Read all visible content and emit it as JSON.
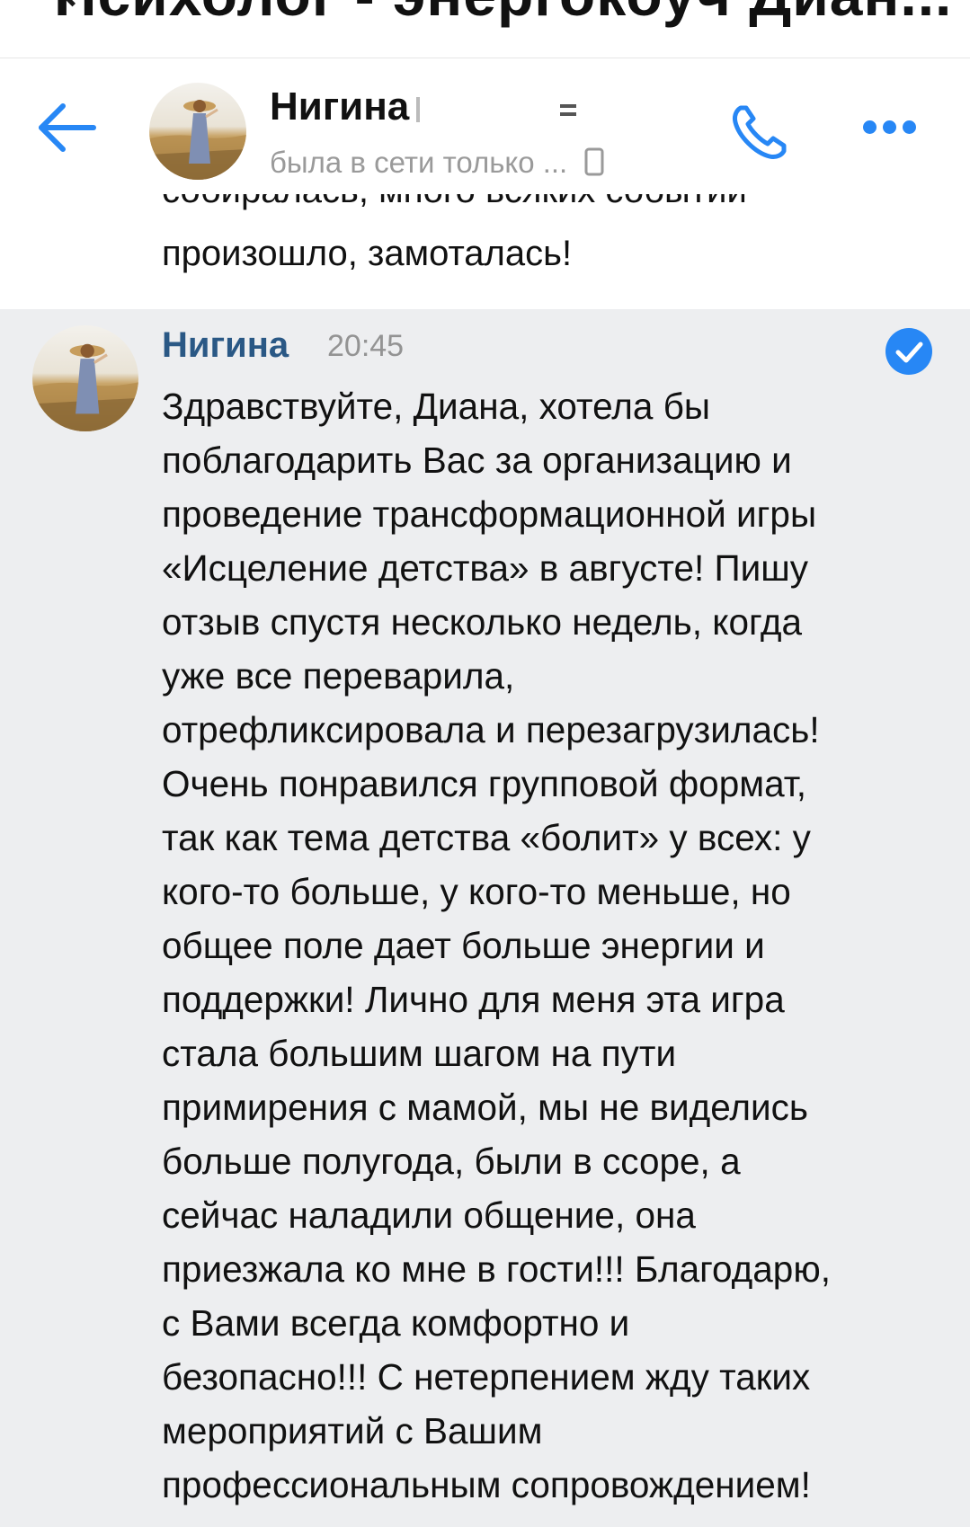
{
  "top_bar": {
    "cut_title": "Психолог - энергокоуч Диан..."
  },
  "header": {
    "contact_name": "Нигина",
    "status": "была в сети только ..."
  },
  "previous_message": {
    "cut_line": "собиралась, много всяких событий",
    "last_line": "произошло, замоталась!"
  },
  "message": {
    "author": "Нигина",
    "time": "20:45",
    "lines": [
      "Здравствуйте, Диана, хотела бы",
      "поблагодарить Вас за организацию и",
      "проведение трансформационной игры",
      "«Исцеление детства» в августе! Пишу",
      "отзыв спустя несколько недель, когда",
      "уже все переварила,",
      "отрефликсировала и перезагрузилась!",
      "Очень понравился групповой формат,",
      "так как тема детства «болит» у всех: у",
      "кого-то больше, у кого-то меньше, но",
      "общее поле дает больше энергии и",
      "поддержки! Лично для меня эта игра",
      "стала большим шагом на пути",
      "примирения с мамой, мы не виделись",
      "больше полугода, были в ссоре, а",
      "сейчас наладили общение, она",
      "приезжала ко мне в гости!!! Благодарю,",
      "с Вами всегда комфортно и",
      "безопасно!!! С нетерпением жду таких",
      "мероприятий с Вашим",
      "профессиональным сопровождением!"
    ]
  },
  "colors": {
    "accent": "#2787f5",
    "author": "#2a5885",
    "selected_bg": "#edeef0",
    "text": "#111111",
    "muted": "#939393"
  },
  "icons": [
    "back-arrow-icon",
    "phone-icon",
    "more-dots-icon",
    "check-circle-icon",
    "phone-device-icon"
  ]
}
